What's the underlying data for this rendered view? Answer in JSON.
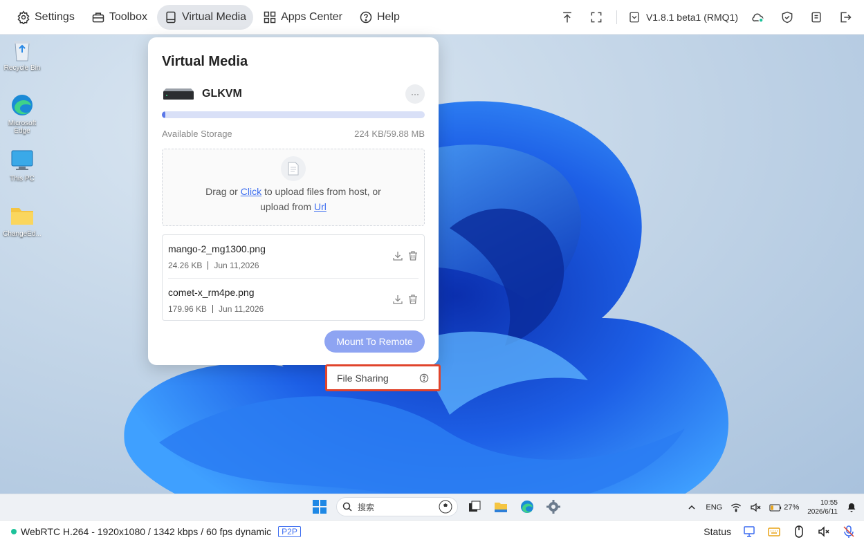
{
  "topbar": {
    "nav": [
      {
        "label": "Settings",
        "icon": "gear-icon"
      },
      {
        "label": "Toolbox",
        "icon": "toolbox-icon"
      },
      {
        "label": "Virtual Media",
        "icon": "media-icon",
        "active": true
      },
      {
        "label": "Apps Center",
        "icon": "apps-icon"
      },
      {
        "label": "Help",
        "icon": "help-icon"
      }
    ],
    "version": "V1.8.1 beta1 (RMQ1)",
    "cloud_status_color": "#1cc29a"
  },
  "desktop": {
    "icons": [
      {
        "label": "Recycle Bin"
      },
      {
        "label": "Microsoft Edge"
      },
      {
        "label": "This PC"
      },
      {
        "label": "ChangeEd..."
      }
    ]
  },
  "panel": {
    "title": "Virtual Media",
    "device_name": "GLKVM",
    "more_label": "···",
    "storage_label": "Available Storage",
    "storage_value": "224 KB/59.88 MB",
    "storage_used_fraction": 0.004,
    "upload": {
      "text_a": "Drag or ",
      "link_click": "Click",
      "text_b": " to upload files from host, or",
      "text_c": "upload from ",
      "link_url": "Url"
    },
    "files": [
      {
        "name": "mango-2_mg1300.png",
        "size": "24.26 KB",
        "date": "Jun 11,2026"
      },
      {
        "name": "comet-x_rm4pe.png",
        "size": "179.96 KB",
        "date": "Jun 11,2026"
      }
    ],
    "mount_button": "Mount To Remote"
  },
  "file_sharing": {
    "label": "File Sharing"
  },
  "taskbar": {
    "search_placeholder": "搜索",
    "lang": "ENG",
    "battery": "27%",
    "time": "10:55",
    "date": "2026/6/11"
  },
  "statusbar": {
    "stream": "WebRTC H.264 - 1920x1080 /  1342 kbps / 60 fps dynamic",
    "mode": "P2P",
    "status_label": "Status",
    "status_color": "#1cc29a"
  },
  "colors": {
    "accent": "#3b6cf0",
    "mount_button": "#8ea4f2",
    "highlight_border": "#e0442c"
  }
}
